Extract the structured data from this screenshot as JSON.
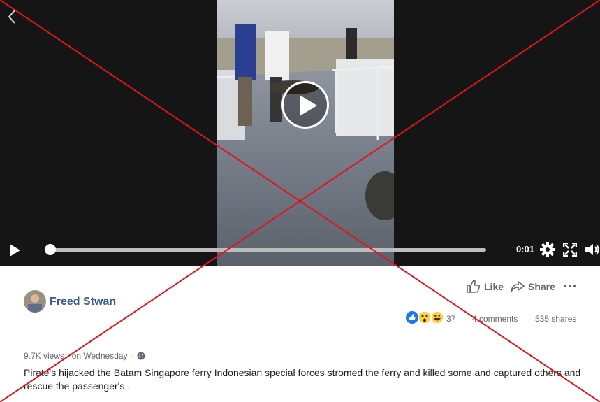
{
  "video": {
    "current_time": "0:01",
    "progress_fraction": 0.0
  },
  "post": {
    "author": "Freed Stwan",
    "actions": {
      "like": "Like",
      "share": "Share"
    },
    "reaction_count": "37",
    "comments": "4 comments",
    "shares": "535 shares",
    "views": "9.7K views",
    "date": "on Wednesday",
    "separator": "·",
    "caption": "Pirate's hijacked the Batam Singapore ferry Indonesian special forces stromed the ferry and killed some and captured others and rescue the passenger's.."
  },
  "icons": {
    "back": "chevron-left-icon",
    "play_overlay": "play-circle-icon",
    "play": "play-icon",
    "settings": "gear-icon",
    "fullscreen": "fullscreen-icon",
    "volume": "volume-icon",
    "like": "thumbs-up-icon",
    "share": "share-arrow-icon",
    "more": "more-dots-icon",
    "privacy": "globe-icon"
  },
  "reactions": [
    "like",
    "wow",
    "haha"
  ],
  "colors": {
    "author_link": "#385898",
    "like_blue": "#1877f2",
    "overlay_x": "#e0141e"
  }
}
